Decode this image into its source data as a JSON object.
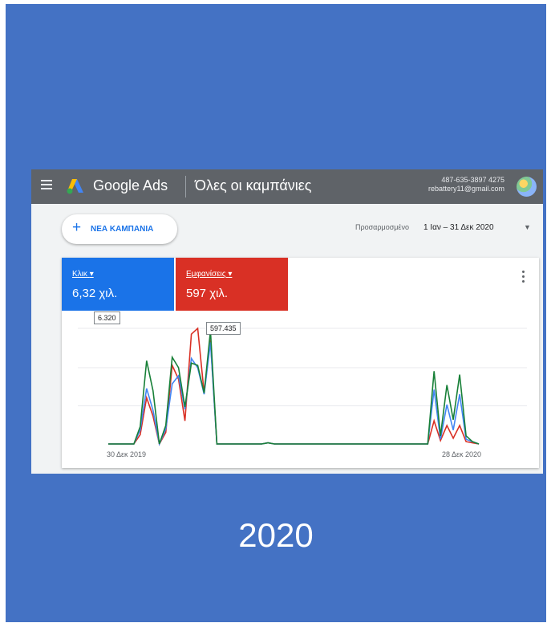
{
  "app": {
    "brand": "Google Ads",
    "page_title": "Όλες οι καμπάνιες",
    "account_id": "487-635-3897 4275",
    "account_email": "rebattery11@gmail.com"
  },
  "toolbar": {
    "new_campaign_label": "ΝΕΑ ΚΑΜΠΑΝΙΑ",
    "date_prefix": "Προσαρμοσμένο",
    "date_range": "1 Ιαν – 31 Δεκ 2020"
  },
  "metrics": {
    "clicks": {
      "label": "Κλικ",
      "value": "6,32 χιλ.",
      "tooltip": "6.320"
    },
    "impressions": {
      "label": "Εμφανίσεις",
      "value": "597 χιλ.",
      "tooltip": "597.435"
    }
  },
  "slide": {
    "caption": "2020"
  },
  "icons": {
    "menu": "hamburger-icon",
    "logo": "google-ads-logo",
    "add": "plus-icon",
    "dropdown": "caret-down-icon",
    "more": "more-vert-icon"
  },
  "colors": {
    "slide_bg": "#4472c4",
    "topbar": "#5f6368",
    "clicks": "#1a73e8",
    "impressions": "#d93025",
    "series_green": "#188038"
  },
  "chart_data": {
    "type": "line",
    "x_tick_labels": [
      "30 Δεκ 2019",
      "28 Δεκ 2020"
    ],
    "x_start": "2019-12-30",
    "x_end": "2020-12-28",
    "x_step": "week",
    "series": [
      {
        "color": "#188038",
        "values": [
          0,
          0,
          0,
          0,
          0,
          0.15,
          0.72,
          0.46,
          0,
          0.16,
          0.75,
          0.66,
          0.32,
          0.7,
          0.68,
          0.44,
          0.98,
          0,
          0,
          0,
          0,
          0,
          0,
          0,
          0,
          0.01,
          0,
          0,
          0,
          0,
          0,
          0,
          0,
          0,
          0,
          0,
          0,
          0,
          0,
          0,
          0,
          0,
          0,
          0,
          0,
          0,
          0,
          0,
          0,
          0,
          0,
          0.63,
          0.07,
          0.51,
          0.21,
          0.6,
          0.07,
          0.02,
          0
        ]
      },
      {
        "color": "#4285f4",
        "values": [
          0,
          0,
          0,
          0,
          0,
          0.12,
          0.48,
          0.29,
          0,
          0.13,
          0.52,
          0.59,
          0.3,
          0.74,
          0.66,
          0.43,
          0.88,
          0,
          0,
          0,
          0,
          0,
          0,
          0,
          0,
          0.01,
          0,
          0,
          0,
          0,
          0,
          0,
          0,
          0,
          0,
          0,
          0,
          0,
          0,
          0,
          0,
          0,
          0,
          0,
          0,
          0,
          0,
          0,
          0,
          0,
          0,
          0.47,
          0.04,
          0.34,
          0.12,
          0.43,
          0.04,
          0.02,
          0
        ]
      },
      {
        "color": "#d93025",
        "values": [
          0,
          0,
          0,
          0,
          0,
          0.08,
          0.4,
          0.24,
          0,
          0.1,
          0.68,
          0.56,
          0.2,
          0.95,
          1.0,
          0.44,
          0.9,
          0,
          0,
          0,
          0,
          0,
          0,
          0,
          0,
          0.01,
          0,
          0,
          0,
          0,
          0,
          0,
          0,
          0,
          0,
          0,
          0,
          0,
          0,
          0,
          0,
          0,
          0,
          0,
          0,
          0,
          0,
          0,
          0,
          0,
          0,
          0.2,
          0.03,
          0.16,
          0.05,
          0.16,
          0.02,
          0.01,
          0
        ]
      }
    ],
    "grid": true
  }
}
